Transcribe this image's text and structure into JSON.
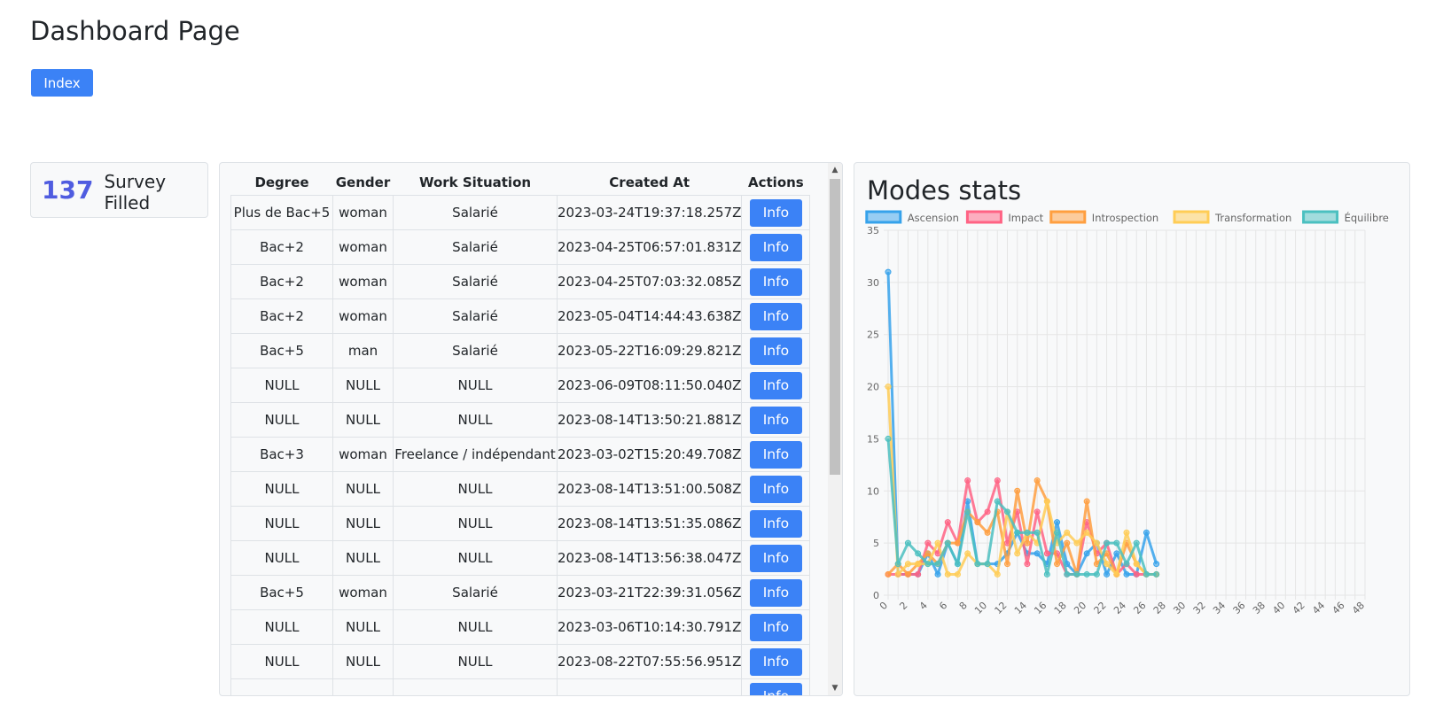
{
  "page": {
    "title": "Dashboard Page",
    "index_label": "Index"
  },
  "stats": {
    "count": "137",
    "label": "Survey Filled"
  },
  "table": {
    "headers": [
      "Degree",
      "Gender",
      "Work Situation",
      "Created At",
      "Actions"
    ],
    "action_label": "Info",
    "rows": [
      [
        "Plus de Bac+5",
        "woman",
        "Salarié",
        "2023-03-24T19:37:18.257Z"
      ],
      [
        "Bac+2",
        "woman",
        "Salarié",
        "2023-04-25T06:57:01.831Z"
      ],
      [
        "Bac+2",
        "woman",
        "Salarié",
        "2023-04-25T07:03:32.085Z"
      ],
      [
        "Bac+2",
        "woman",
        "Salarié",
        "2023-05-04T14:44:43.638Z"
      ],
      [
        "Bac+5",
        "man",
        "Salarié",
        "2023-05-22T16:09:29.821Z"
      ],
      [
        "NULL",
        "NULL",
        "NULL",
        "2023-06-09T08:11:50.040Z"
      ],
      [
        "NULL",
        "NULL",
        "NULL",
        "2023-08-14T13:50:21.881Z"
      ],
      [
        "Bac+3",
        "woman",
        "Freelance / indépendant",
        "2023-03-02T15:20:49.708Z"
      ],
      [
        "NULL",
        "NULL",
        "NULL",
        "2023-08-14T13:51:00.508Z"
      ],
      [
        "NULL",
        "NULL",
        "NULL",
        "2023-08-14T13:51:35.086Z"
      ],
      [
        "NULL",
        "NULL",
        "NULL",
        "2023-08-14T13:56:38.047Z"
      ],
      [
        "Bac+5",
        "woman",
        "Salarié",
        "2023-03-21T22:39:31.056Z"
      ],
      [
        "NULL",
        "NULL",
        "NULL",
        "2023-03-06T10:14:30.791Z"
      ],
      [
        "NULL",
        "NULL",
        "NULL",
        "2023-08-22T07:55:56.951Z"
      ],
      [
        "",
        "",
        "",
        ""
      ]
    ]
  },
  "chart": {
    "title": "Modes stats"
  },
  "chart_data": {
    "type": "line",
    "title": "Modes stats",
    "x": [
      0,
      1,
      2,
      3,
      4,
      5,
      6,
      7,
      8,
      9,
      10,
      11,
      12,
      13,
      14,
      15,
      16,
      17,
      18,
      19,
      20,
      21,
      22,
      23,
      24,
      25,
      26,
      27,
      28,
      29,
      30,
      31,
      32,
      33,
      34,
      35,
      36,
      37,
      38,
      39,
      40,
      41,
      42,
      43,
      44,
      45,
      46,
      47,
      48
    ],
    "x_ticks": [
      0,
      2,
      4,
      6,
      8,
      10,
      12,
      14,
      16,
      18,
      20,
      22,
      24,
      26,
      28,
      30,
      32,
      34,
      36,
      38,
      40,
      42,
      44,
      46,
      48
    ],
    "ylim": [
      0,
      35
    ],
    "y_ticks": [
      0,
      5,
      10,
      15,
      20,
      25,
      30,
      35
    ],
    "grid": true,
    "legend_position": "top",
    "series": [
      {
        "name": "Ascension",
        "color": "#36a2eb",
        "values": [
          31,
          2,
          2,
          2,
          4,
          2,
          5,
          3,
          9,
          3,
          3,
          3,
          4,
          6,
          4,
          4,
          3,
          7,
          3,
          2,
          4,
          5,
          2,
          4,
          2,
          2,
          6,
          3
        ]
      },
      {
        "name": "Impact",
        "color": "#ff6384",
        "values": [
          2,
          2,
          2,
          2,
          5,
          4,
          7,
          5,
          11,
          7,
          8,
          11,
          5,
          8,
          3,
          8,
          4,
          4,
          2,
          2,
          7,
          4,
          5,
          2,
          3,
          2,
          2,
          2
        ]
      },
      {
        "name": "Introspection",
        "color": "#ff9f40",
        "values": [
          2,
          3,
          2,
          3,
          4,
          3,
          5,
          5,
          8,
          7,
          6,
          8,
          3,
          10,
          5,
          11,
          9,
          3,
          5,
          2,
          9,
          3,
          4,
          2,
          5,
          3,
          2,
          2
        ]
      },
      {
        "name": "Transformation",
        "color": "#ffcd56",
        "values": [
          20,
          2,
          3,
          3,
          3,
          5,
          2,
          2,
          4,
          3,
          3,
          2,
          8,
          4,
          6,
          5,
          9,
          5,
          6,
          5,
          6,
          5,
          3,
          2,
          6,
          3,
          2,
          2
        ]
      },
      {
        "name": "Équilibre",
        "color": "#4bc0c0",
        "values": [
          15,
          3,
          5,
          4,
          3,
          3,
          5,
          3,
          8,
          3,
          3,
          9,
          8,
          6,
          6,
          6,
          2,
          6,
          2,
          2,
          2,
          2,
          5,
          5,
          3,
          5,
          2,
          2
        ]
      }
    ]
  }
}
